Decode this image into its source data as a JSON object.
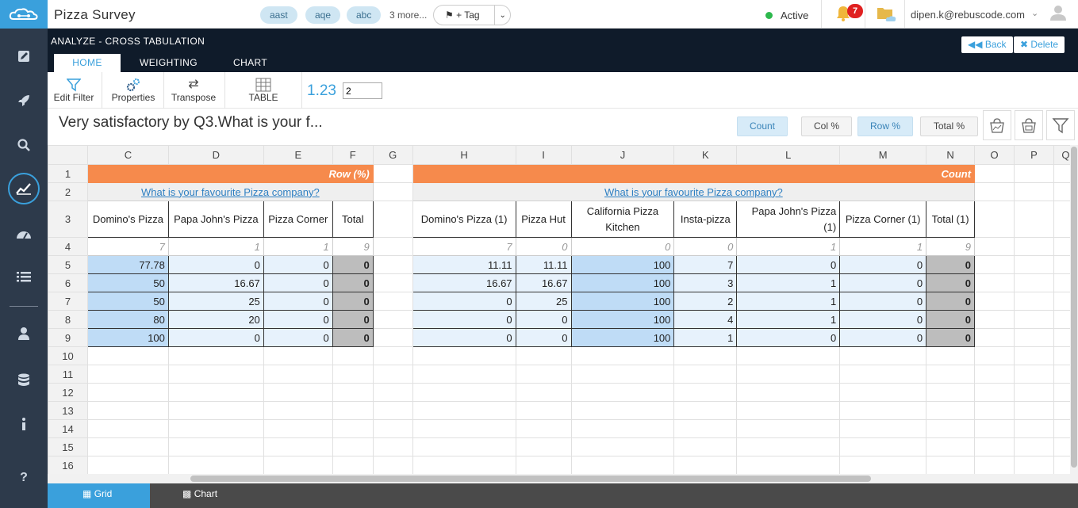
{
  "app": {
    "title": "Pizza Survey"
  },
  "tags": {
    "chips": [
      "aast",
      "aqe",
      "abc"
    ],
    "more": "3 more...",
    "add_label": "+ Tag"
  },
  "status": {
    "label": "Active"
  },
  "notifications": {
    "count": "7"
  },
  "user": {
    "email": "dipen.k@rebuscode.com"
  },
  "header": {
    "section_title": "ANALYZE - CROSS TABULATION",
    "tabs": [
      "HOME",
      "WEIGHTING",
      "CHART"
    ],
    "back_label": "Back",
    "delete_label": "Delete"
  },
  "toolbar": {
    "edit_filter": "Edit Filter",
    "properties": "Properties",
    "transpose": "Transpose",
    "table": "TABLE",
    "decimals_label": "1.23",
    "decimals_value": "2"
  },
  "table_title": "Very satisfactory by Q3.What is your f...",
  "modes": [
    "Count",
    "Col %",
    "Row %",
    "Total %"
  ],
  "grid": {
    "columns": [
      "C",
      "D",
      "E",
      "F",
      "G",
      "H",
      "I",
      "J",
      "K",
      "L",
      "M",
      "N",
      "O",
      "P",
      "Q"
    ],
    "rows": [
      "1",
      "2",
      "3",
      "4",
      "5",
      "6",
      "7",
      "8",
      "9",
      "10",
      "11",
      "12",
      "13",
      "14",
      "15",
      "16"
    ],
    "left": {
      "banner": "Row (%)",
      "question": "What is your favourite Pizza company?",
      "headers": [
        "Domino's Pizza",
        "Papa John's Pizza",
        "Pizza Corner",
        "Total"
      ],
      "base": [
        "7",
        "1",
        "1",
        "9"
      ],
      "values": [
        [
          "77.78",
          "0",
          "0",
          "0"
        ],
        [
          "50",
          "16.67",
          "0",
          "0"
        ],
        [
          "50",
          "25",
          "0",
          "0"
        ],
        [
          "80",
          "20",
          "0",
          "0"
        ],
        [
          "100",
          "0",
          "0",
          "0"
        ]
      ]
    },
    "right": {
      "banner": "Count",
      "question": "What is your favourite Pizza company?",
      "headers": [
        "Domino's Pizza (1)",
        "Pizza Hut",
        "California Pizza Kitchen",
        "Insta-pizza",
        "Papa John's Pizza (1)",
        "Pizza Corner (1)",
        "Total (1)"
      ],
      "base": [
        "7",
        "0",
        "0",
        "0",
        "1",
        "1",
        "9"
      ],
      "values": [
        [
          "11.11",
          "11.11",
          "100",
          "7",
          "0",
          "0",
          "0"
        ],
        [
          "16.67",
          "16.67",
          "100",
          "3",
          "1",
          "0",
          "0"
        ],
        [
          "0",
          "25",
          "100",
          "2",
          "1",
          "0",
          "0"
        ],
        [
          "0",
          "0",
          "100",
          "4",
          "1",
          "0",
          "0"
        ],
        [
          "0",
          "0",
          "100",
          "1",
          "0",
          "0",
          "0"
        ]
      ]
    }
  },
  "bottom_tabs": [
    "Grid",
    "Chart"
  ]
}
